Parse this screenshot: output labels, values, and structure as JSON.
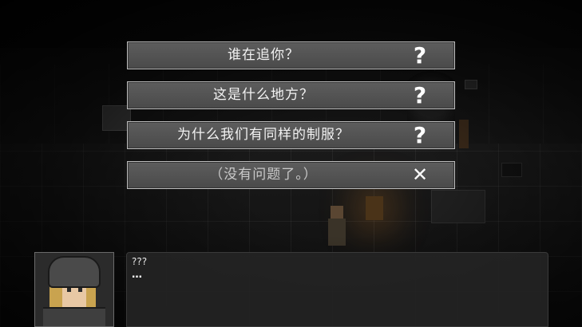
{
  "choices": [
    {
      "label": "谁在追你？",
      "icon": "question-mark-icon",
      "glyph": "?"
    },
    {
      "label": "这是什么地方？",
      "icon": "question-mark-icon",
      "glyph": "?"
    },
    {
      "label": "为什么我们有同样的制服？",
      "icon": "question-mark-icon",
      "glyph": "?"
    },
    {
      "label": "（没有问题了。）",
      "icon": "close-icon",
      "glyph": "✕"
    }
  ],
  "dialog": {
    "speaker": "???",
    "text": "…"
  },
  "colors": {
    "choice_bg": "#555555",
    "choice_border": "#bdbdbd",
    "dialog_bg": "#242424",
    "text": "#f2f2f2"
  }
}
